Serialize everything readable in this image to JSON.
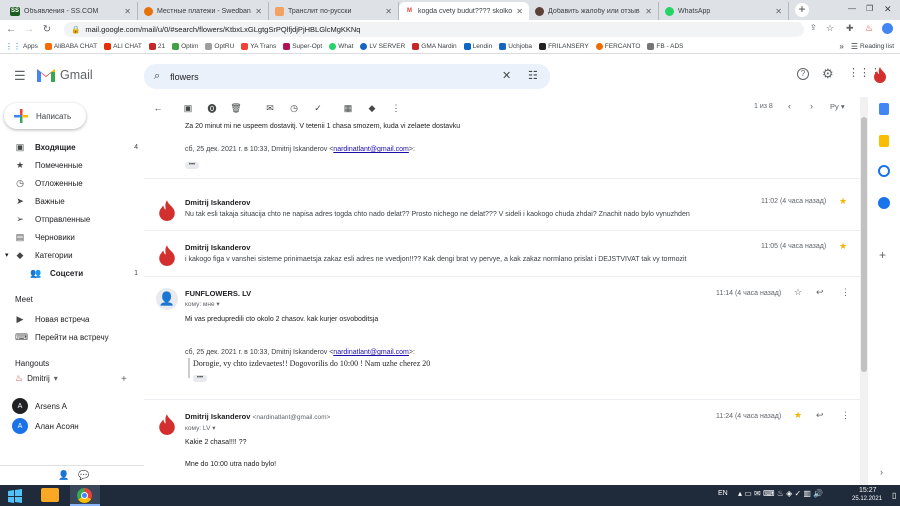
{
  "browser": {
    "tabs": [
      {
        "label": "Объявления - SS.COM",
        "icon_color": "#1b5e20",
        "icon_text": "SS"
      },
      {
        "label": "Местные платежи - Swedbank",
        "icon_color": "#e8710a",
        "icon_text": ""
      },
      {
        "label": "Транслит по-русски",
        "icon_color": "#f4a261",
        "icon_text": ""
      },
      {
        "label": "kogda cvety budut???? skolko c",
        "icon_color": "#ea4335",
        "icon_text": "M"
      },
      {
        "label": "Добавить жалобу или отзыв",
        "icon_color": "#5d4037",
        "icon_text": ""
      },
      {
        "label": "WhatsApp",
        "icon_color": "#25d366",
        "icon_text": ""
      }
    ],
    "url": "mail.google.com/mail/u/0/#search/flowers/KtbxLxGLgtgSrPQlfjdjPjHBLGlcMgKKNq",
    "bookmarks": [
      "Apps",
      "AliBABA CHAT",
      "ALI CHAT",
      "21",
      "Optim",
      "OptRU",
      "YA Trans",
      "Super-Opt",
      "What",
      "LV SERVER",
      "GMA Nardin",
      "Lendin",
      "Uchjoba",
      "FRILANSERY",
      "FERCANTO",
      "FB - ADS"
    ],
    "reading_list": "Reading list"
  },
  "gmail": {
    "logo": "Gmail",
    "search_value": "flowers",
    "compose": "Написать",
    "nav": [
      {
        "label": "Входящие",
        "icon": "inbox-icon",
        "glyph": "▣",
        "count": "4",
        "bold": true
      },
      {
        "label": "Помеченные",
        "icon": "star-icon",
        "glyph": "★",
        "count": ""
      },
      {
        "label": "Отложенные",
        "icon": "clock-icon",
        "glyph": "◷",
        "count": ""
      },
      {
        "label": "Важные",
        "icon": "important-icon",
        "glyph": "➤",
        "count": ""
      },
      {
        "label": "Отправленные",
        "icon": "send-icon",
        "glyph": "➢",
        "count": ""
      },
      {
        "label": "Черновики",
        "icon": "draft-icon",
        "glyph": "▤",
        "count": ""
      },
      {
        "label": "Категории",
        "icon": "label-icon",
        "glyph": "◆",
        "count": ""
      },
      {
        "label": "Соцсети",
        "icon": "people-icon",
        "glyph": "👥",
        "count": "1",
        "bold": true
      }
    ],
    "meet": {
      "title": "Meet",
      "items": [
        "Новая встреча",
        "Перейти на встречу"
      ]
    },
    "hangouts": {
      "title": "Hangouts",
      "me": "Dmitrij",
      "contacts": [
        {
          "name": "Arsens A",
          "initial": "A",
          "color": "#202124"
        },
        {
          "name": "Алан Асоян",
          "initial": "A",
          "color": "#1a73e8"
        }
      ]
    },
    "pagination": "1 из 8",
    "lang": "Ру"
  },
  "thread": {
    "top_line": "Za 20 minut mi ne uspeem dostavitj. V tetenii 1 chasa smozem, kuda vi zelaete dostavku",
    "top_quote_header": "сб, 25 дек. 2021 г. в 10:33, Dmitrij Iskanderov <",
    "top_quote_email": "nardinatlant@gmail.com",
    "top_quote_tail": ">:",
    "messages": [
      {
        "sender": "Dmitrij Iskanderov",
        "snippet": "Nu tak esli takaja situacija chto ne napisa adres togda chto nado delat?? Prosto nichego ne delat??? V sideli i kaokogo chuda zhdai? Znachit nado bylo vynuzhden",
        "time": "11:02 (4 часа назад)"
      },
      {
        "sender": "Dmitrij Iskanderov",
        "snippet": "i kakogo figa v vanshei sisteme prinimaetsja zakaz esli adres ne vvedjon!!?? Kak dengi brat vy pervye, a kak zakaz normlano prislat i DEJSTVIVAT tak vy tormozit",
        "time": "11:05 (4 часа назад)"
      },
      {
        "sender": "FUNFLOWERS. LV",
        "to": "кому: мне",
        "body": "Mi vas predupredili cto okolo 2 chasov. kak kurjer osvoboditsja",
        "quote_header": "сб, 25 дек. 2021 г. в 10:33, Dmitrij Iskanderov <",
        "quote_email": "nardinatlant@gmail.com",
        "quote_tail": ">:",
        "quote_text": "Dorogie, vy chto izdevaetes!! Dogovorilis do 10:00 ! Nam uzhe cherez 20",
        "time": "11:14 (4 часа назад)"
      },
      {
        "sender": "Dmitrij Iskanderov",
        "email": "<nardinatlant@gmail.com>",
        "to": "кому: LV",
        "body1": "Kakie 2 chasa!!!! ??",
        "body2": "Mne do 10:00 utra nado bylo!",
        "time": "11:24 (4 часа назад)"
      }
    ]
  },
  "taskbar": {
    "lang": "EN",
    "time": "15:27",
    "date": "25.12.2021"
  }
}
